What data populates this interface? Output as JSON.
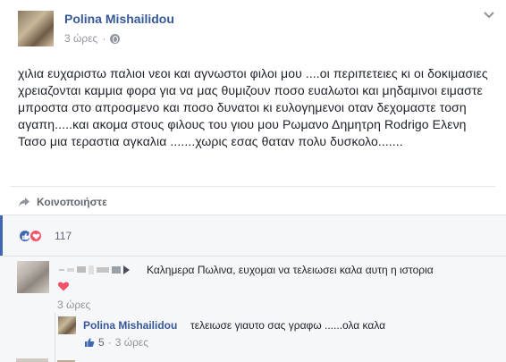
{
  "post": {
    "author": "Polina Mishailidou",
    "time": "3 ώρες",
    "separator": "·",
    "audience_icon": "globe-icon",
    "text": "χιλια ευχαριστω παλιοι νεοι και αγνωστοι φιλοι μου ....οι περιπετειες κι οι δοκιμασιες χρειαζονται καμμια φορα για να μας θυμιζουν ποσο ευαλωτοι και μηδαμινοι ειμαστε μπροστα στο απροσμενο και ποσο δυνατοι κι ευλογημενοι οταν δεχομαστε τοση αγαπη.....και ακομα στους φιλους του γιου μου Ρωμανο Δημητρη Rodrigo Ελενη Τασο μια τεραστια αγκαλια .......χωρις εσας θαταν πολυ δυσκολο.......",
    "share_label": "Κοινοποιήστε"
  },
  "reactions": {
    "count": "117",
    "types": [
      "like-icon",
      "love-icon"
    ]
  },
  "comments": [
    {
      "text": "Καλημερα Πωλινα, ευχομαι να τελειωσει καλα αυτη η ιστορια",
      "time": "3 ώρες",
      "reaction": "love-icon"
    }
  ],
  "reply": {
    "author": "Polina Mishailidou",
    "text": "τελειωσε γιαυτο σας γραφω ......ολα καλα",
    "likes": "5",
    "separator": "·",
    "time": "3 ώρες"
  },
  "colors": {
    "link": "#365899",
    "muted": "#90949c",
    "like": "#4267b2",
    "love": "#f25268",
    "panel": "#f6f7f9"
  }
}
